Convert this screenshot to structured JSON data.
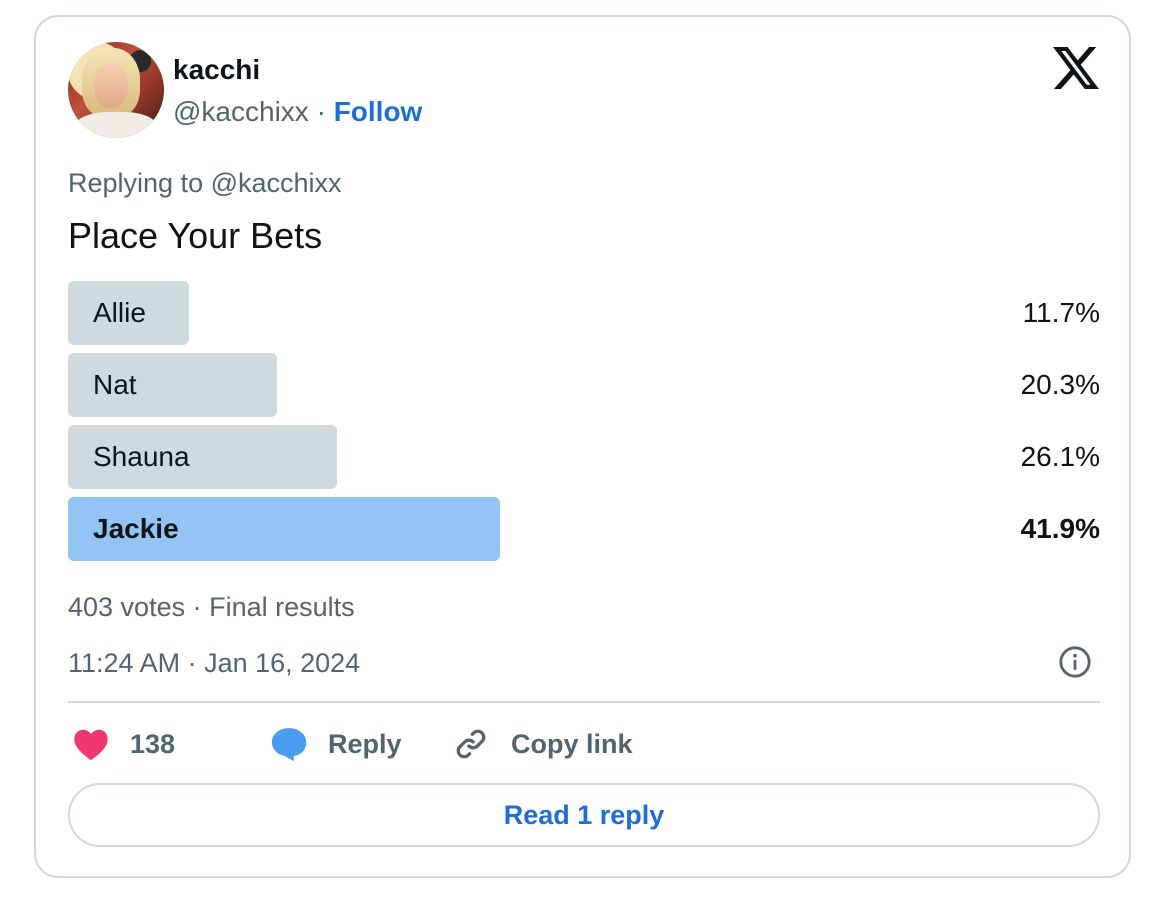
{
  "author": {
    "name": "kacchi",
    "handle": "@kacchixx",
    "separator": "·",
    "follow_label": "Follow"
  },
  "logo_icon": "x-logo-icon",
  "replying_to": "Replying to @kacchixx",
  "poll": {
    "question": "Place Your Bets",
    "options": [
      {
        "label": "Allie",
        "percent": 11.7,
        "percent_text": "11.7%",
        "winner": false
      },
      {
        "label": "Nat",
        "percent": 20.3,
        "percent_text": "20.3%",
        "winner": false
      },
      {
        "label": "Shauna",
        "percent": 26.1,
        "percent_text": "26.1%",
        "winner": false
      },
      {
        "label": "Jackie",
        "percent": 41.9,
        "percent_text": "41.9%",
        "winner": true
      }
    ],
    "summary": "403 votes · Final results"
  },
  "timestamp": "11:24 AM · Jan 16, 2024",
  "colors": {
    "accent": "#1d6fd6",
    "winner_bar": "#93c4f3",
    "bar": "#cfd9de",
    "like": "#f0376f",
    "reply_icon": "#4a9cf0",
    "muted_text": "#536471"
  },
  "actions": {
    "likes_count": "138",
    "reply_label": "Reply",
    "copy_link_label": "Copy link"
  },
  "read_replies_label": "Read 1 reply"
}
